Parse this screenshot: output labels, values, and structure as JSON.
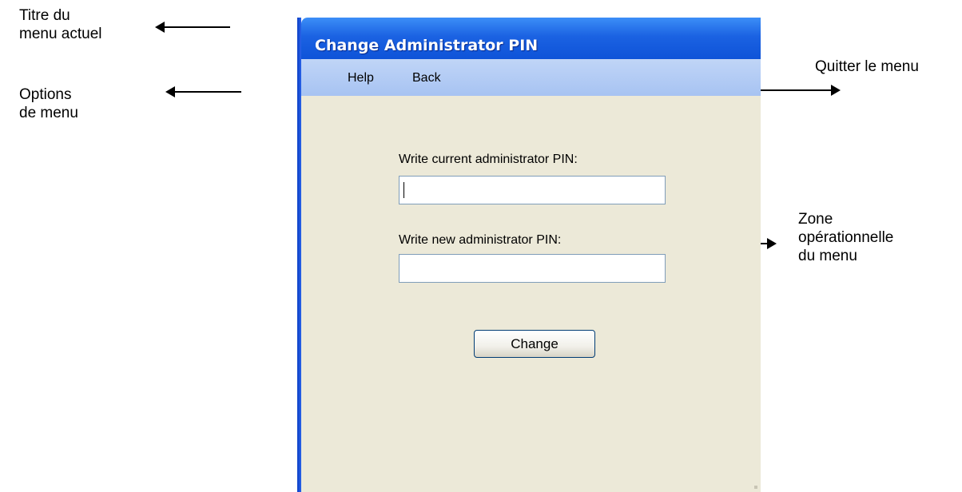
{
  "annotations": {
    "title": "Titre du\nmenu actuel",
    "options": "Options\nde menu",
    "quit": "Quitter le menu",
    "zone": "Zone\nopérationnelle\ndu menu"
  },
  "window": {
    "title": "Change Administrator PIN",
    "menu": [
      {
        "label": "Help"
      },
      {
        "label": "Back"
      }
    ],
    "form": {
      "current_pin_label": "Write current administrator PIN:",
      "current_pin_value": "",
      "new_pin_label": "Write new administrator PIN:",
      "new_pin_value": "",
      "change_button": "Change"
    }
  },
  "colors": {
    "titlebar": "#1b62e2",
    "menubar": "#a7c3f2",
    "content_bg": "#ece9d8"
  },
  "icons": [
    "arrow-left-icon",
    "arrow-right-icon"
  ]
}
